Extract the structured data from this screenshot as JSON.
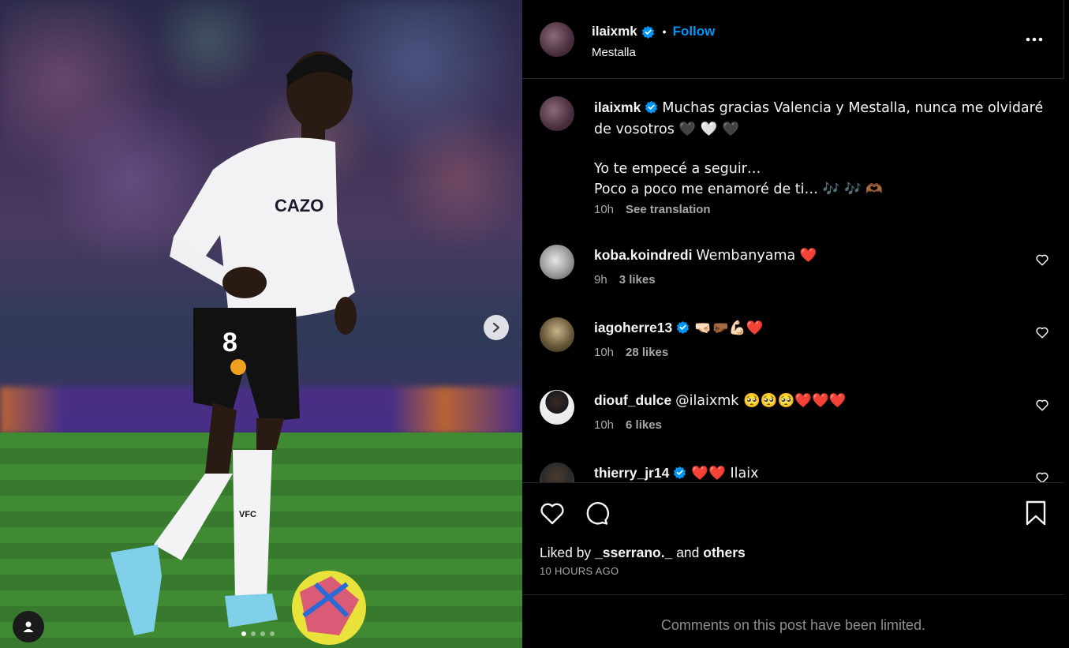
{
  "post": {
    "author": "ilaixmk",
    "follow_label": "Follow",
    "separator": "•",
    "location": "Mestalla",
    "more_label": "More options"
  },
  "caption": {
    "username": "ilaixmk",
    "line1": "Muchas gracias Valencia y Mestalla, nunca me olvidaré de vosotros 🖤 🤍 🖤",
    "line2": "Yo te empecé a seguir…",
    "line3": "Poco a poco me enamoré de ti… 🎶 🎶 🫶🏾",
    "time": "10h",
    "see_translation": "See translation"
  },
  "comments": [
    {
      "username": "koba.koindredi",
      "verified": false,
      "text": "Wembanyama ❤️",
      "time": "9h",
      "likes": "3 likes"
    },
    {
      "username": "iagoherre13",
      "verified": true,
      "text": "🤜🏻🤛🏾💪🏻❤️",
      "time": "10h",
      "likes": "28 likes"
    },
    {
      "username": "diouf_dulce",
      "verified": false,
      "text": "@ilaixmk 🥺🥺🥺❤️❤️❤️",
      "time": "10h",
      "likes": "6 likes"
    },
    {
      "username": "thierry_jr14",
      "verified": true,
      "text": "❤️❤️ Ilaix",
      "time": "",
      "likes": ""
    }
  ],
  "actions": {
    "liked_by_prefix": "Liked by",
    "liked_by_user": "_sserrano._",
    "liked_by_and": "and",
    "liked_by_others": "others",
    "timestamp": "10 HOURS AGO"
  },
  "footer": {
    "limited_text": "Comments on this post have been limited."
  },
  "carousel": {
    "dot_count": 4,
    "active_index": 0
  },
  "colors": {
    "accent": "#0095f6",
    "background": "#000000",
    "muted": "#a8a8a8",
    "heart": "#ff3040"
  }
}
